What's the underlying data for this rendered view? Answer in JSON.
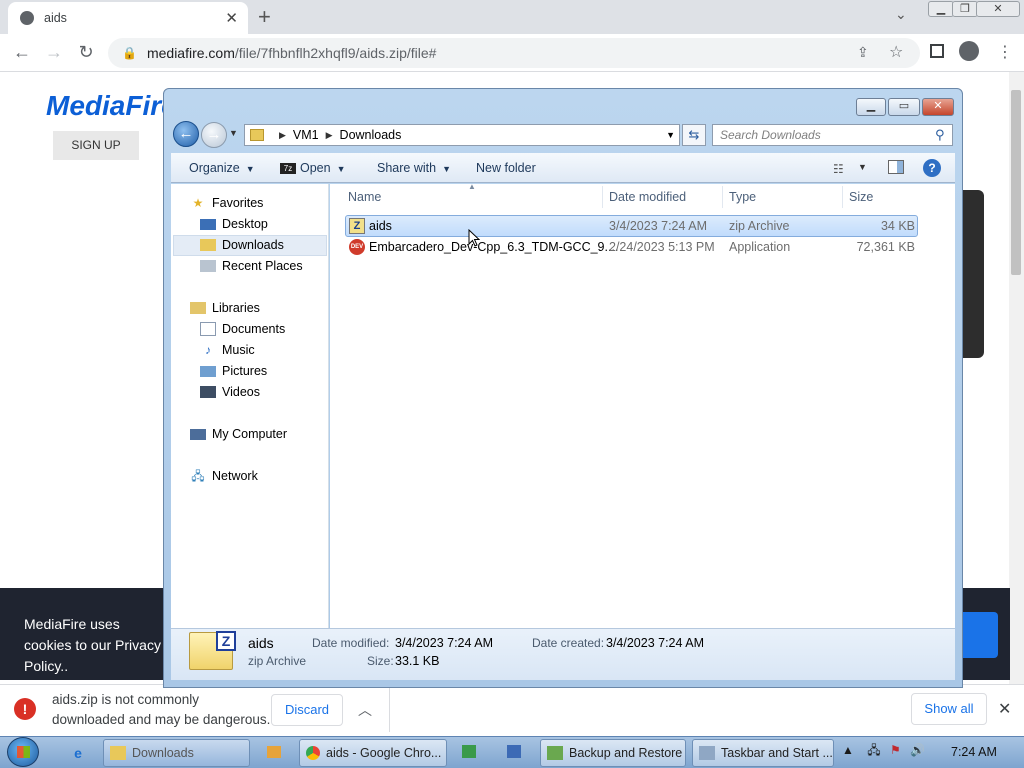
{
  "browser": {
    "tab_title": "aids",
    "url_host": "mediafire.com",
    "url_path": "/file/7fhbnflh2xhqfl9/aids.zip/file#",
    "new_tab_label": "+",
    "tab_close": "✕"
  },
  "page": {
    "logo_text": "MediaFire",
    "signup_label": "SIGN UP",
    "cookie_text": "MediaFire uses cookies to our Privacy Policy.."
  },
  "download_bar": {
    "warning_text": "aids.zip is not commonly downloaded and may be dangerous.",
    "discard_label": "Discard",
    "show_all_label": "Show all"
  },
  "explorer": {
    "breadcrumb": [
      "VM1",
      "Downloads"
    ],
    "search_placeholder": "Search Downloads",
    "commands": {
      "organize": "Organize",
      "open": "Open",
      "share_with": "Share with",
      "new_folder": "New folder"
    },
    "nav": {
      "favorites": "Favorites",
      "desktop": "Desktop",
      "downloads": "Downloads",
      "recent_places": "Recent Places",
      "libraries": "Libraries",
      "documents": "Documents",
      "music": "Music",
      "pictures": "Pictures",
      "videos": "Videos",
      "my_computer": "My Computer",
      "network": "Network"
    },
    "columns": {
      "name": "Name",
      "date_modified": "Date modified",
      "type": "Type",
      "size": "Size"
    },
    "files": [
      {
        "name": "aids",
        "date": "3/4/2023 7:24 AM",
        "type": "zip Archive",
        "size": "34 KB"
      },
      {
        "name": "Embarcadero_Dev-Cpp_6.3_TDM-GCC_9....",
        "date": "2/24/2023 5:13 PM",
        "type": "Application",
        "size": "72,361 KB"
      }
    ],
    "details": {
      "name": "aids",
      "type": "zip Archive",
      "date_modified_label": "Date modified:",
      "date_modified": "3/4/2023 7:24 AM",
      "date_created_label": "Date created:",
      "date_created": "3/4/2023 7:24 AM",
      "size_label": "Size:",
      "size": "33.1 KB"
    }
  },
  "taskbar": {
    "buttons": {
      "downloads": "Downloads",
      "chrome": "aids - Google Chro...",
      "backup": "Backup and Restore",
      "taskbar_start": "Taskbar and Start ..."
    },
    "clock": "7:24 AM"
  },
  "colors": {
    "chrome_tabstrip": "#dee1e6",
    "mediafire_blue": "#0c5fd6",
    "explorer_frame": "#bcd6ef",
    "selection": "#c1dcfc",
    "taskbar": "#7ea4cf"
  }
}
